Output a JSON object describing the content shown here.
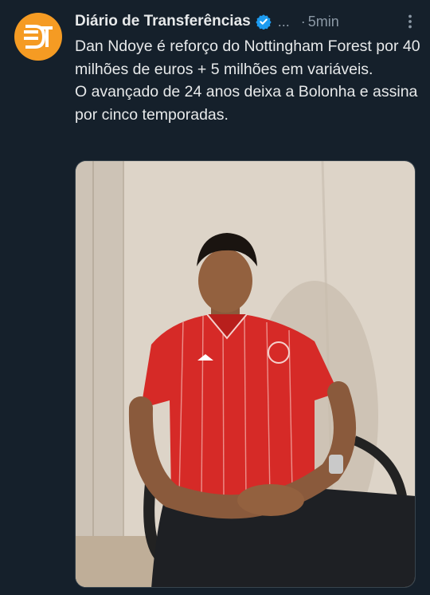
{
  "tweet": {
    "author_name": "Diário de Transferências",
    "handle_truncated": "...",
    "separator": "·",
    "timestamp": "5min",
    "text_lines": [
      "Dan Ndoye é reforço do Nottingham Forest por 40 milhões de euros + 5 milhões em variáveis.",
      "O avançado de 24 anos deixa a Bolonha e assina por cinco temporadas."
    ]
  },
  "icons": {
    "verified": "verified-badge-icon",
    "more": "more-options-icon"
  },
  "colors": {
    "background": "#15202b",
    "avatar": "#f59b23",
    "verified": "#1d9bf0",
    "secondary_text": "#8b98a5",
    "jersey": "#d62a27"
  }
}
